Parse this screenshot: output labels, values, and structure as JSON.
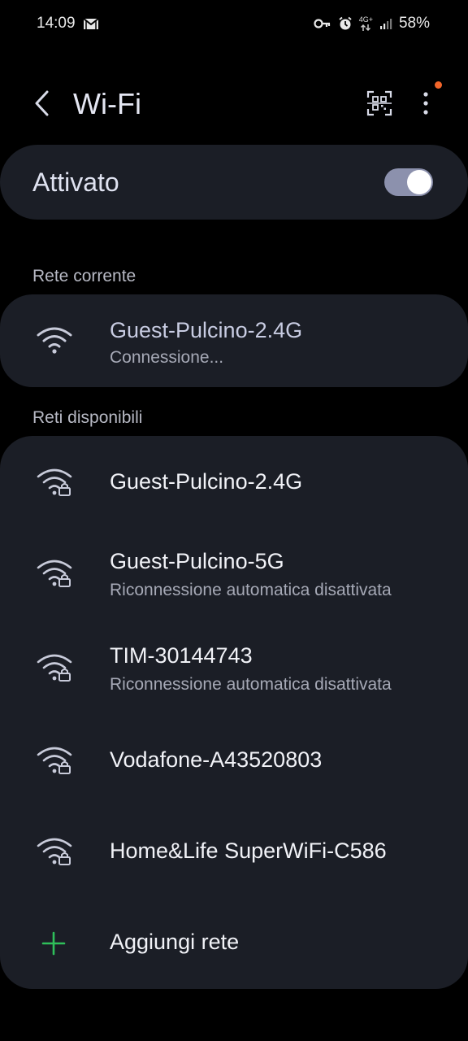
{
  "status_bar": {
    "time": "14:09",
    "battery": "58%",
    "network": "4G+",
    "icons": [
      "gmail-icon",
      "vpn-key-icon",
      "alarm-icon",
      "data-arrows-icon",
      "signal-icon"
    ]
  },
  "header": {
    "title": "Wi-Fi",
    "icons": [
      "back-arrow-icon",
      "qr-code-scan-icon",
      "more-vert-icon"
    ],
    "notification_dot_color": "#f2652a"
  },
  "master_switch": {
    "label": "Attivato",
    "state": true,
    "track_color": "#8c91ad"
  },
  "current_network": {
    "section_label": "Rete corrente",
    "name": "Guest-Pulcino-2.4G",
    "status": "Connessione..."
  },
  "available_networks": {
    "section_label": "Reti disponibili",
    "items": [
      {
        "name": "Guest-Pulcino-2.4G",
        "subtitle": ""
      },
      {
        "name": "Guest-Pulcino-5G",
        "subtitle": "Riconnessione automatica disattivata"
      },
      {
        "name": "TIM-30144743",
        "subtitle": "Riconnessione automatica disattivata"
      },
      {
        "name": "Vodafone-A43520803",
        "subtitle": ""
      },
      {
        "name": "Home&Life SuperWiFi-C586",
        "subtitle": ""
      }
    ],
    "add_network_label": "Aggiungi rete",
    "add_icon_color": "#2fbf5a"
  },
  "colors": {
    "background": "#000000",
    "card": "#1b1e26",
    "accent": "#8c91ad"
  }
}
